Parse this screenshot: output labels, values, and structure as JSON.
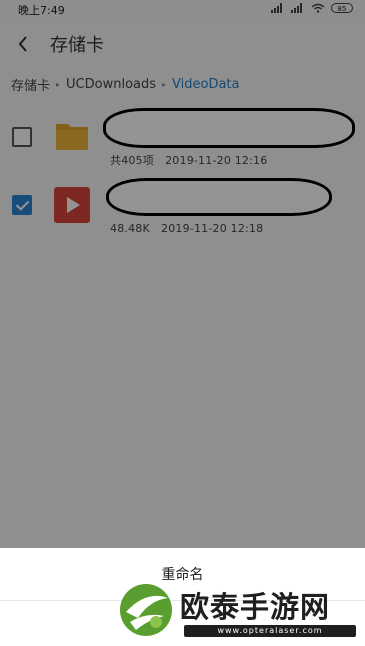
{
  "status_bar": {
    "time": "晚上7:49",
    "battery": "85"
  },
  "header": {
    "title": "存储卡"
  },
  "breadcrumb": {
    "items": [
      "存储卡",
      "UCDownloads",
      "VideoData"
    ],
    "separator": "▸"
  },
  "files": [
    {
      "type": "folder",
      "checked": false,
      "info": "共405项",
      "date": "2019-11-20 12:16"
    },
    {
      "type": "video",
      "checked": true,
      "info": "48.48K",
      "date": "2019-11-20 12:18"
    }
  ],
  "sheet": {
    "title": "重命名"
  },
  "watermark": {
    "brand": "欧泰手游网",
    "url": "www.opteralaser.com"
  },
  "colors": {
    "accent": "#2a7fc8",
    "folder": "#e3a62a",
    "video": "#d9453b",
    "watermark_green": "#5a9e2f"
  },
  "icons": [
    "back-arrow-icon",
    "folder-icon",
    "video-play-icon",
    "checkbox-icon",
    "signal-icon",
    "wifi-icon",
    "battery-icon"
  ]
}
